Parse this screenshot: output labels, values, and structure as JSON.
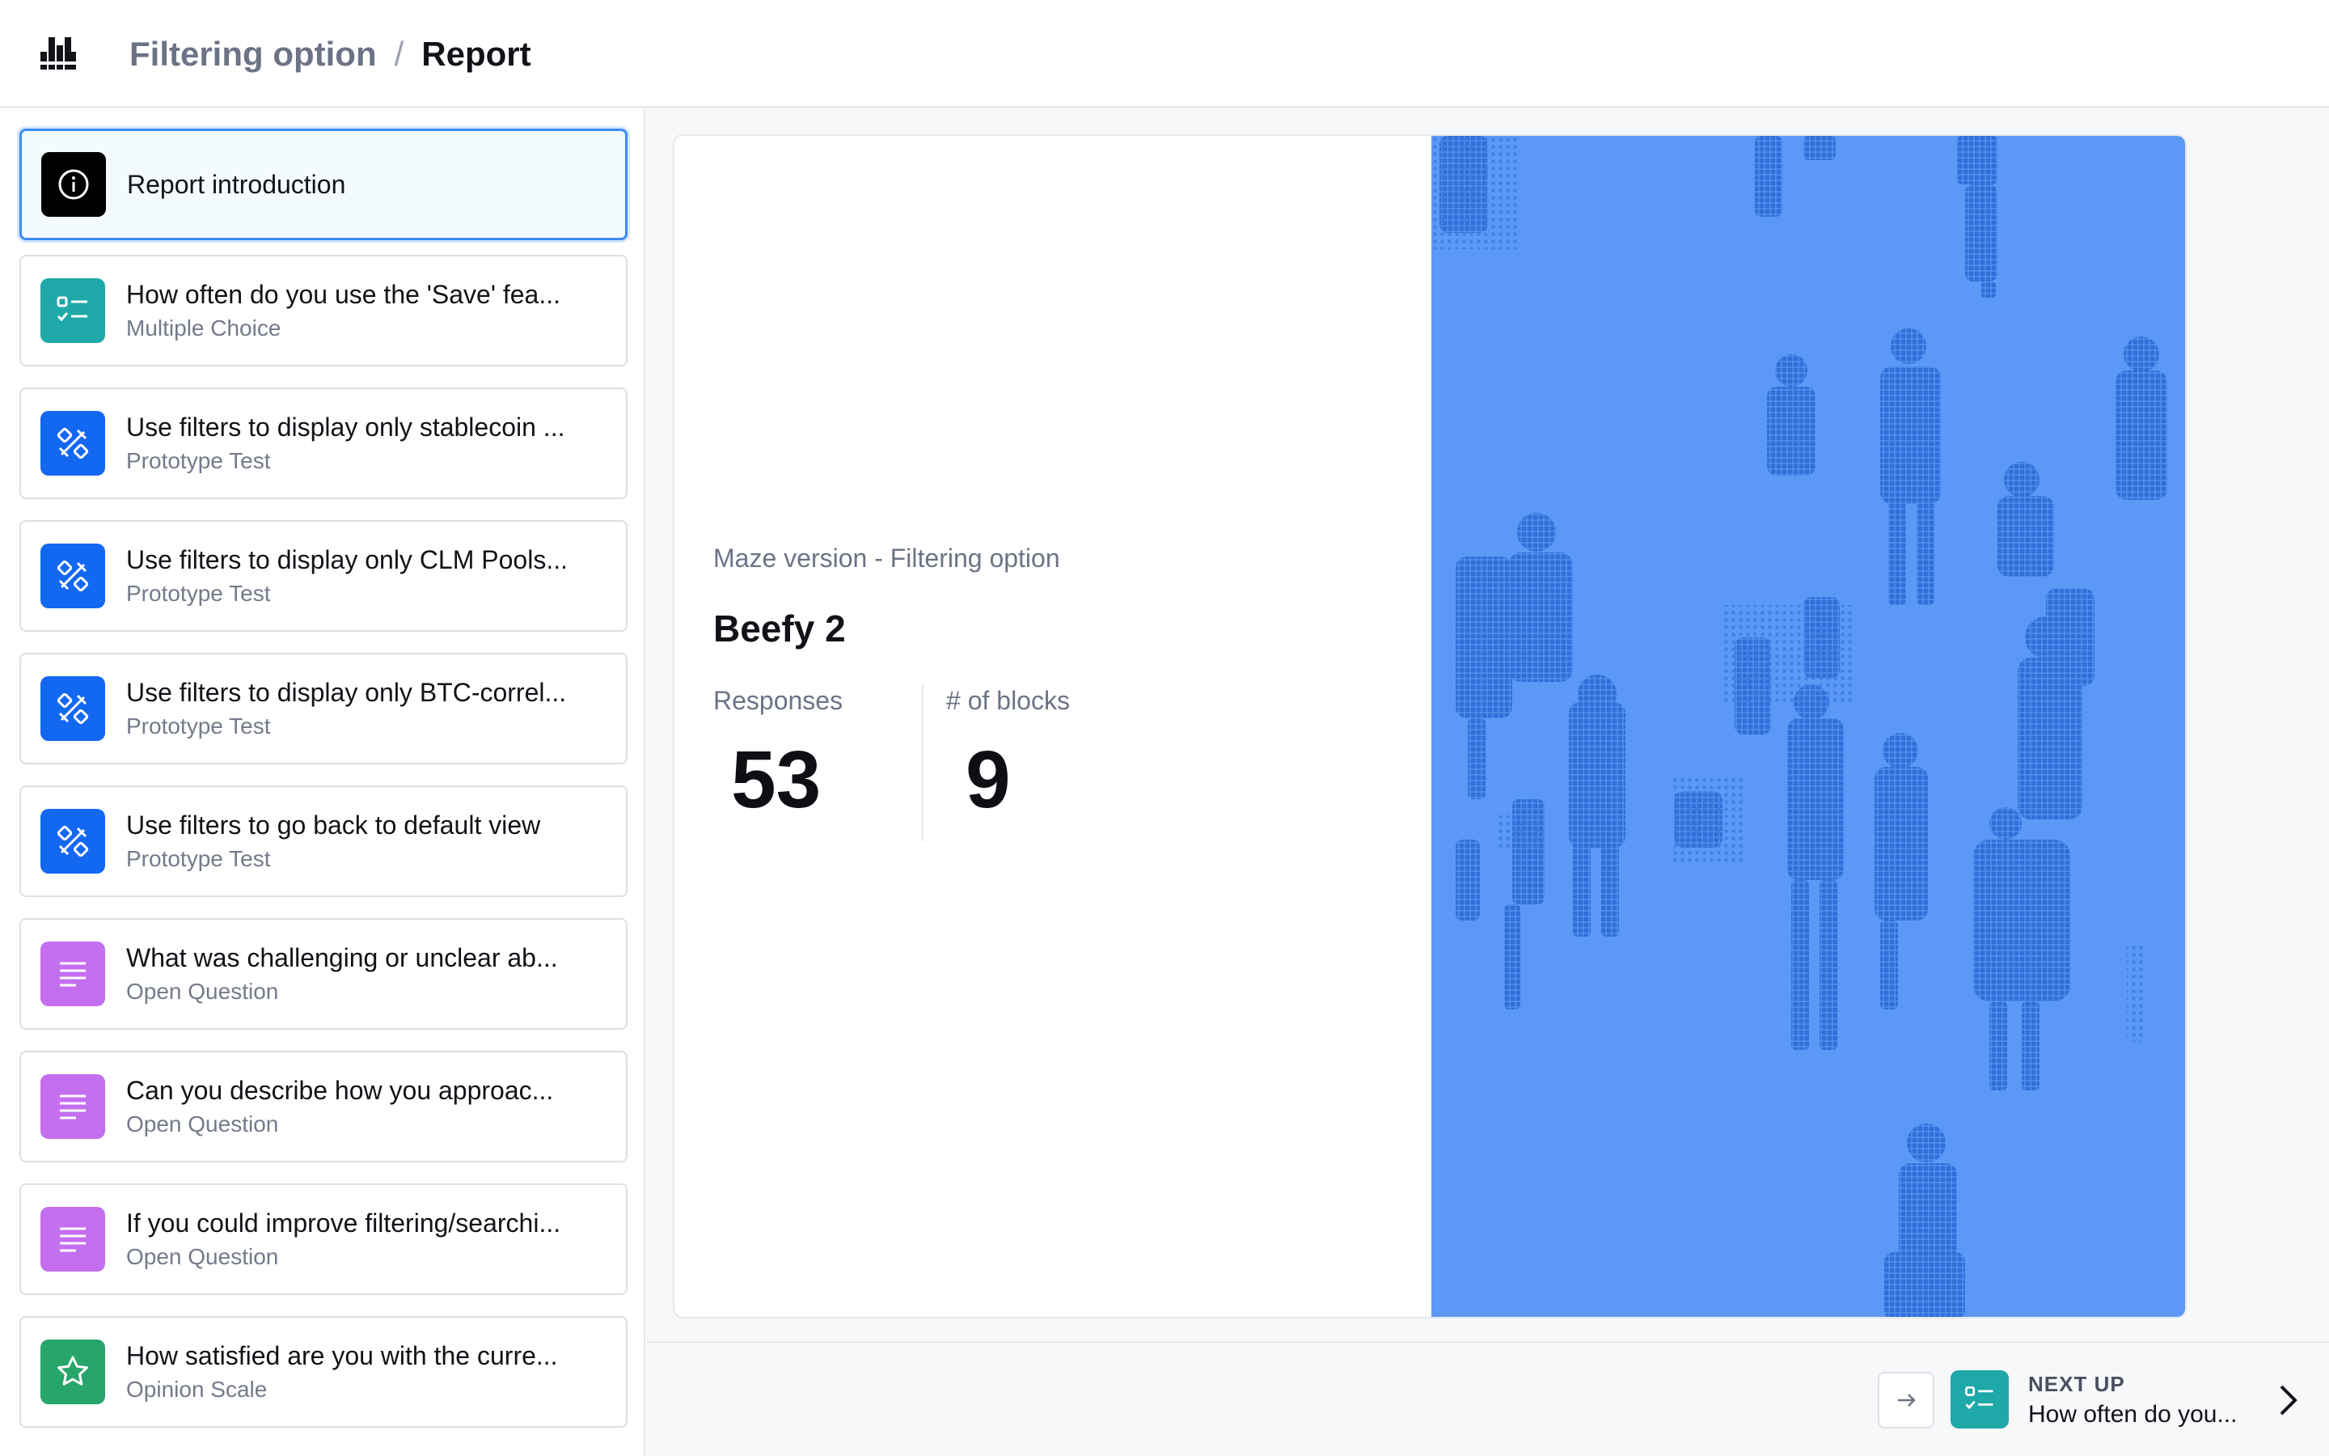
{
  "header": {
    "parent": "Filtering option",
    "separator": "/",
    "current": "Report"
  },
  "sidebar": {
    "blocks": [
      {
        "title": "Report introduction",
        "subtitle": "",
        "icon": "info-icon",
        "color": "#000000"
      },
      {
        "title": "How often do you use the 'Save' fea...",
        "subtitle": "Multiple Choice",
        "icon": "multiple-choice-icon",
        "color": "#1fa8a8"
      },
      {
        "title": "Use filters to display only stablecoin ...",
        "subtitle": "Prototype Test",
        "icon": "prototype-icon",
        "color": "#1368f2"
      },
      {
        "title": "Use filters to display only CLM Pools...",
        "subtitle": "Prototype Test",
        "icon": "prototype-icon",
        "color": "#1368f2"
      },
      {
        "title": "Use filters to display only BTC-correl...",
        "subtitle": "Prototype Test",
        "icon": "prototype-icon",
        "color": "#1368f2"
      },
      {
        "title": "Use filters to go back to default view",
        "subtitle": "Prototype Test",
        "icon": "prototype-icon",
        "color": "#1368f2"
      },
      {
        "title": "What was challenging or unclear ab...",
        "subtitle": "Open Question",
        "icon": "open-question-icon",
        "color": "#c46ef0"
      },
      {
        "title": "Can you describe how you approac...",
        "subtitle": "Open Question",
        "icon": "open-question-icon",
        "color": "#c46ef0"
      },
      {
        "title": "If you could improve filtering/searchi...",
        "subtitle": "Open Question",
        "icon": "open-question-icon",
        "color": "#c46ef0"
      },
      {
        "title": "How satisfied are you with the curre...",
        "subtitle": "Opinion Scale",
        "icon": "star-icon",
        "color": "#27a56a"
      }
    ]
  },
  "card": {
    "meta": "Maze version - Filtering option",
    "title": "Beefy 2",
    "stats": [
      {
        "label": "Responses",
        "value": "53"
      },
      {
        "label": "# of blocks",
        "value": "9"
      }
    ],
    "cover_color": "#5c98f5"
  },
  "footer": {
    "next_label": "NEXT UP",
    "next_title": "How often do you..."
  }
}
